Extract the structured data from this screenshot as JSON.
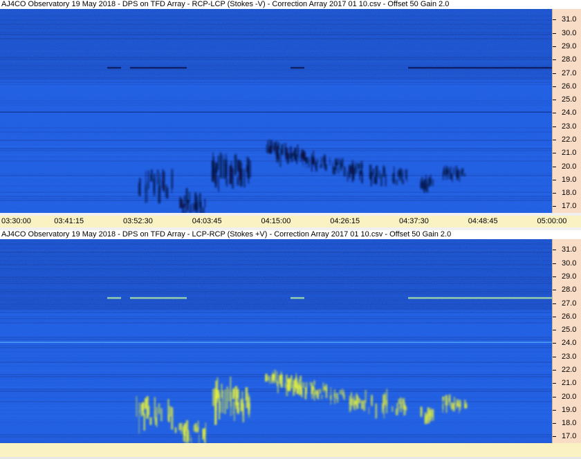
{
  "chart_data": [
    {
      "type": "heatmap",
      "title": "AJ4CO Observatory 19 May 2018  -  DPS on TFD Array  -  RCP-LCP (Stokes -V)  -  Correction Array 2017 01 10.csv  -  Offset 50  Gain 2.0",
      "x_tick_labels": [
        "03:30:00",
        "03:41:15",
        "03:52:30",
        "04:03:45",
        "04:15:00",
        "04:26:15",
        "04:37:30",
        "04:48:45",
        "05:00:00"
      ],
      "y_tick_labels": [
        "31.0",
        "30.0",
        "29.0",
        "28.0",
        "27.0",
        "26.0",
        "25.0",
        "24.0",
        "23.0",
        "22.0",
        "21.0",
        "20.0",
        "19.0",
        "18.0",
        "17.0"
      ],
      "xlim": [
        "03:30:00",
        "05:00:00"
      ],
      "ylim": [
        16.5,
        31.8
      ],
      "colormap": {
        "background": "#1e5fe8",
        "dark": "#0b1a6a",
        "light": "#3f8cff"
      },
      "burst_color": "#081040",
      "interference_lines": [
        27.4,
        24.1
      ],
      "burst_events": [
        {
          "time": "03:55:00",
          "freq": 18.6,
          "fw": 1.8,
          "dt": 3.0,
          "intensity": 0.9
        },
        {
          "time": "04:01:00",
          "freq": 17.2,
          "fw": 1.3,
          "dt": 2.5,
          "intensity": 1.0
        },
        {
          "time": "04:06:30",
          "freq": 19.7,
          "fw": 2.0,
          "dt": 2.0,
          "intensity": 1.0
        },
        {
          "time": "04:09:30",
          "freq": 19.5,
          "fw": 1.6,
          "dt": 1.3,
          "intensity": 0.8
        },
        {
          "time": "04:14:30",
          "freq": 21.4,
          "fw": 0.7,
          "dt": 1.3,
          "intensity": 0.8
        },
        {
          "time": "04:17:00",
          "freq": 20.9,
          "fw": 1.0,
          "dt": 2.0,
          "intensity": 0.9
        },
        {
          "time": "04:19:30",
          "freq": 20.6,
          "fw": 0.9,
          "dt": 1.8,
          "intensity": 0.8
        },
        {
          "time": "04:22:00",
          "freq": 20.3,
          "fw": 0.8,
          "dt": 1.5,
          "intensity": 0.6
        },
        {
          "time": "04:25:00",
          "freq": 20.0,
          "fw": 0.8,
          "dt": 1.3,
          "intensity": 0.5
        },
        {
          "time": "04:28:00",
          "freq": 19.6,
          "fw": 1.0,
          "dt": 1.5,
          "intensity": 0.7
        },
        {
          "time": "04:31:30",
          "freq": 19.4,
          "fw": 1.2,
          "dt": 1.5,
          "intensity": 0.6
        },
        {
          "time": "04:35:00",
          "freq": 19.2,
          "fw": 1.0,
          "dt": 1.3,
          "intensity": 0.5
        },
        {
          "time": "04:39:30",
          "freq": 18.7,
          "fw": 1.0,
          "dt": 1.0,
          "intensity": 0.6
        },
        {
          "time": "04:43:00",
          "freq": 19.5,
          "fw": 0.8,
          "dt": 1.0,
          "intensity": 0.6
        },
        {
          "time": "04:45:00",
          "freq": 19.4,
          "fw": 0.7,
          "dt": 0.8,
          "intensity": 0.4
        }
      ]
    },
    {
      "type": "heatmap",
      "title": "AJ4CO Observatory 19 May 2018  -  DPS on TFD Array  -  LCP-RCP (Stokes +V)  -  Correction Array 2017 01 10.csv  -  Offset 50  Gain 2.0",
      "x_tick_labels": [],
      "y_tick_labels": [
        "31.0",
        "30.0",
        "29.0",
        "28.0",
        "27.0",
        "26.0",
        "25.0",
        "24.0",
        "23.0",
        "22.0",
        "21.0",
        "20.0",
        "19.0",
        "18.0",
        "17.0"
      ],
      "xlim": [
        "03:30:00",
        "05:00:00"
      ],
      "ylim": [
        16.5,
        31.8
      ],
      "colormap": {
        "background": "#1e5fe8",
        "dark": "#0b1a6a",
        "light": "#3f8cff"
      },
      "burst_color": "#e6f23a",
      "interference_lines": [
        27.4,
        24.1
      ],
      "burst_events": [
        {
          "time": "03:55:00",
          "freq": 18.6,
          "fw": 1.8,
          "dt": 3.0,
          "intensity": 0.9
        },
        {
          "time": "04:01:00",
          "freq": 17.2,
          "fw": 1.3,
          "dt": 2.5,
          "intensity": 1.0
        },
        {
          "time": "04:06:30",
          "freq": 19.7,
          "fw": 2.0,
          "dt": 2.0,
          "intensity": 1.0
        },
        {
          "time": "04:09:30",
          "freq": 19.5,
          "fw": 1.6,
          "dt": 1.3,
          "intensity": 0.8
        },
        {
          "time": "04:14:30",
          "freq": 21.4,
          "fw": 0.7,
          "dt": 1.3,
          "intensity": 0.8
        },
        {
          "time": "04:17:00",
          "freq": 20.9,
          "fw": 1.0,
          "dt": 2.0,
          "intensity": 0.9
        },
        {
          "time": "04:19:30",
          "freq": 20.6,
          "fw": 0.9,
          "dt": 1.8,
          "intensity": 0.8
        },
        {
          "time": "04:22:00",
          "freq": 20.3,
          "fw": 0.8,
          "dt": 1.5,
          "intensity": 0.6
        },
        {
          "time": "04:25:00",
          "freq": 20.0,
          "fw": 0.8,
          "dt": 1.3,
          "intensity": 0.5
        },
        {
          "time": "04:28:00",
          "freq": 19.6,
          "fw": 1.0,
          "dt": 1.5,
          "intensity": 0.7
        },
        {
          "time": "04:31:30",
          "freq": 19.4,
          "fw": 1.2,
          "dt": 1.5,
          "intensity": 0.6
        },
        {
          "time": "04:35:00",
          "freq": 19.2,
          "fw": 1.0,
          "dt": 1.3,
          "intensity": 0.5
        },
        {
          "time": "04:39:30",
          "freq": 18.7,
          "fw": 1.0,
          "dt": 1.0,
          "intensity": 0.6
        },
        {
          "time": "04:43:00",
          "freq": 19.5,
          "fw": 0.8,
          "dt": 1.0,
          "intensity": 0.6
        },
        {
          "time": "04:45:00",
          "freq": 19.4,
          "fw": 0.7,
          "dt": 0.8,
          "intensity": 0.4
        }
      ]
    }
  ]
}
